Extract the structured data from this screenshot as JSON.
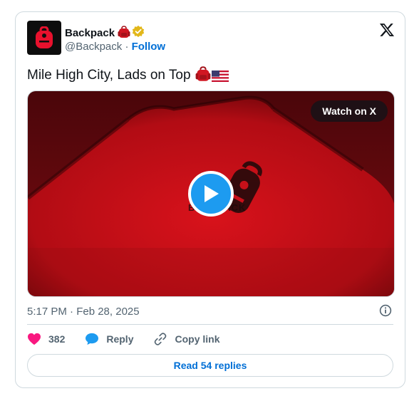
{
  "tweet": {
    "author_name": "Backpack",
    "handle": "@Backpack",
    "separator": "·",
    "follow_label": "Follow",
    "text": "Mile High City, Lads on Top",
    "video_overlay_label": "Watch on X",
    "timestamp": "5:17 PM · Feb 28, 2025",
    "like_count": "382",
    "reply_label": "Reply",
    "copy_link_label": "Copy link",
    "read_replies_label": "Read 54 replies",
    "video_brand_text": "BACKPACK"
  },
  "icons": {
    "avatar": "backpack-logo-icon",
    "name_emoji": "red-backpack-emoji-icon",
    "verified": "verified-gold-badge-icon",
    "text_emoji_1": "red-backpack-emoji-icon",
    "text_emoji_2": "us-flag-emoji-icon",
    "platform": "x-logo-icon",
    "play": "play-icon",
    "info": "info-icon",
    "like": "heart-icon",
    "reply": "reply-bubble-icon",
    "copy": "link-icon"
  },
  "colors": {
    "accent": "#1d9bf0",
    "link": "#006fd6",
    "like": "#f91880",
    "media_red": "#d0141c",
    "verified_gold": "#e2b719"
  }
}
